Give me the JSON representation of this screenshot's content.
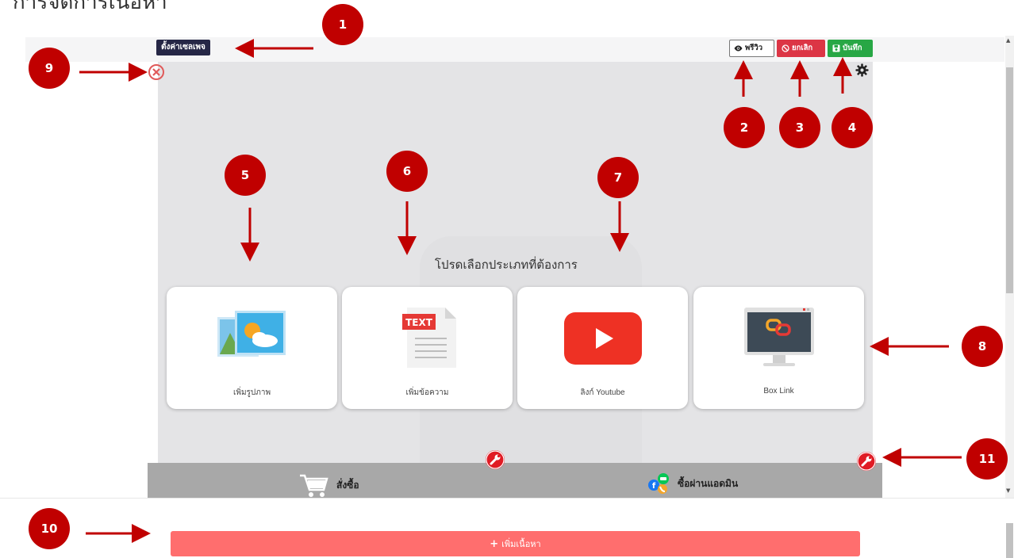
{
  "clipped_heading": "การจัดการเนื้อหา",
  "toolbar": {
    "page_settings_label": "ตั้งค่าเซลเพจ",
    "preview_label": "พรีวิว",
    "cancel_label": "ยกเลิก",
    "save_label": "บันทึก"
  },
  "canvas": {
    "choose_title": "โปรดเลือกประเภทที่ต้องการ",
    "cards": [
      {
        "label": "เพิ่มรูปภาพ",
        "icon": "image-icon"
      },
      {
        "label": "เพิ่มข้อความ",
        "icon": "text-document-icon",
        "icon_text": "TEXT"
      },
      {
        "label": "ลิงก์ Youtube",
        "icon": "youtube-play-icon"
      },
      {
        "label": "Box Link",
        "icon": "monitor-link-icon"
      }
    ]
  },
  "bottom_bar": {
    "order_label": "สั่งซื้อ",
    "admin_label": "ซื้อผ่านแอดมิน"
  },
  "add_content_label": "เพิ่มเนื้อหา",
  "markers": [
    "1",
    "2",
    "3",
    "4",
    "5",
    "6",
    "7",
    "8",
    "9",
    "10",
    "11"
  ],
  "colors": {
    "marker": "#c00000",
    "cancel": "#dc3545",
    "save": "#28a745",
    "add_content": "#ff6e6e",
    "settings_button": "#262746"
  }
}
